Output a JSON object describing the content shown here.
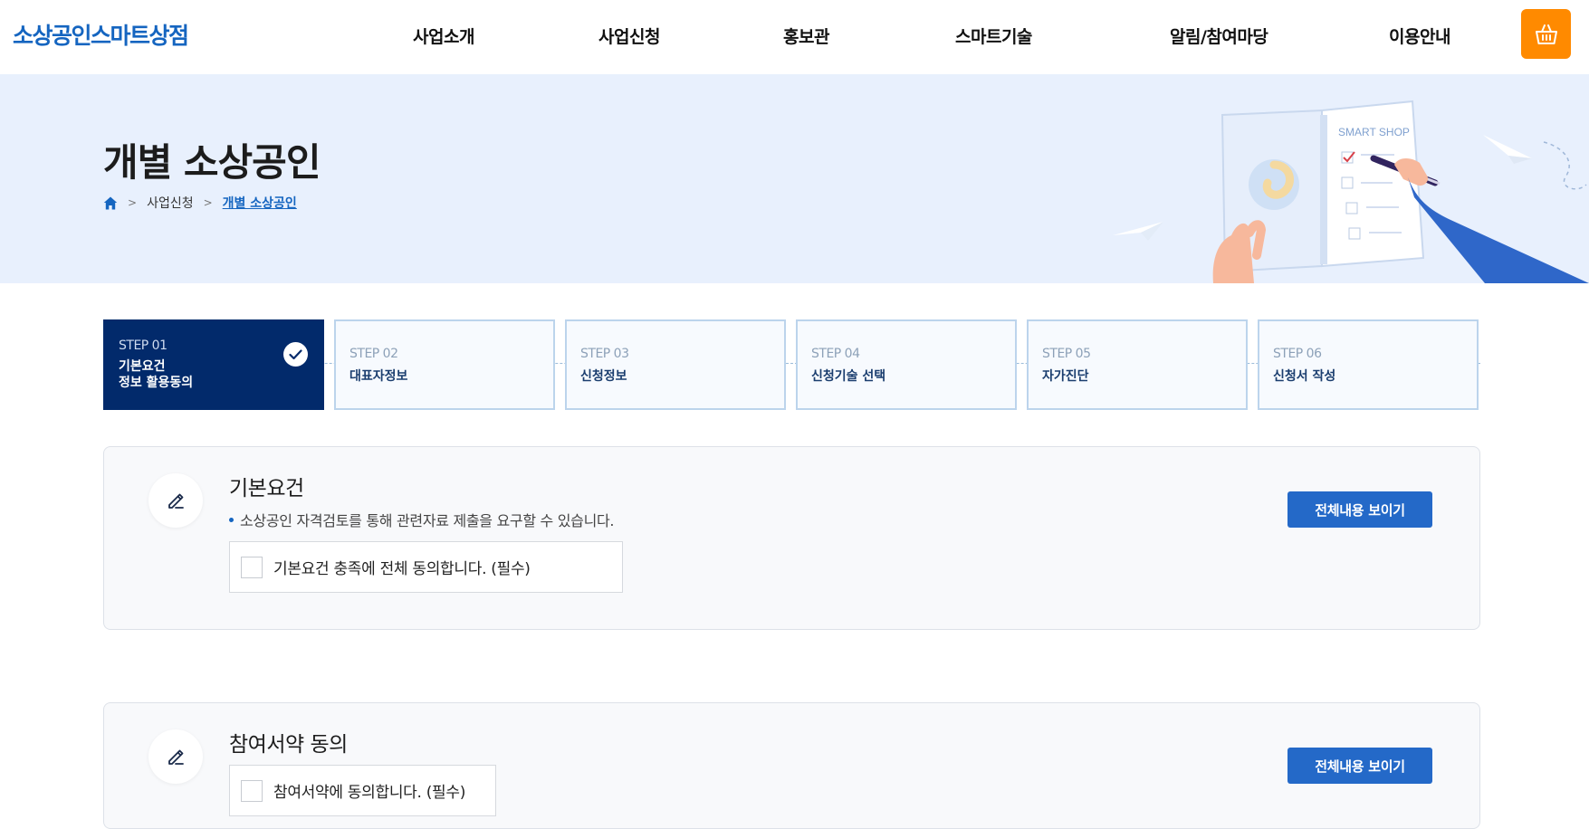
{
  "header": {
    "logo": "소상공인스마트상점",
    "nav": [
      "사업소개",
      "사업신청",
      "홍보관",
      "스마트기술",
      "알림/참여마당",
      "이용안내"
    ],
    "cart_icon": "basket-icon",
    "accent_color": "#ff8a00"
  },
  "hero": {
    "title": "개별 소상공인",
    "breadcrumb": [
      "사업신청",
      "개별 소상공인"
    ],
    "illustration_label": "SMART SHOP"
  },
  "steps": [
    {
      "num": "STEP 01",
      "label": "기본요건\n정보 활용동의",
      "status": "completed"
    },
    {
      "num": "STEP 02",
      "label": "대표자정보",
      "status": "pending"
    },
    {
      "num": "STEP 03",
      "label": "신청정보",
      "status": "pending"
    },
    {
      "num": "STEP 04",
      "label": "신청기술 선택",
      "status": "pending"
    },
    {
      "num": "STEP 05",
      "label": "자가진단",
      "status": "pending"
    },
    {
      "num": "STEP 06",
      "label": "신청서 작성",
      "status": "pending"
    }
  ],
  "sections": [
    {
      "title": "기본요건",
      "note": "소상공인 자격검토를 통해 관련자료 제출을 요구할 수 있습니다.",
      "checkbox_label": "기본요건 충족에 전체 동의합니다. (필수)",
      "checked": false,
      "button": "전체내용 보이기"
    },
    {
      "title": "참여서약 동의",
      "checkbox_label": "참여서약에 동의합니다. (필수)",
      "checked": false,
      "button": "전체내용 보이기"
    }
  ],
  "colors": {
    "brand": "#1565c0",
    "step_active": "#022a6b",
    "button": "#2469c8",
    "hero_bg": "#e8f0fd"
  }
}
